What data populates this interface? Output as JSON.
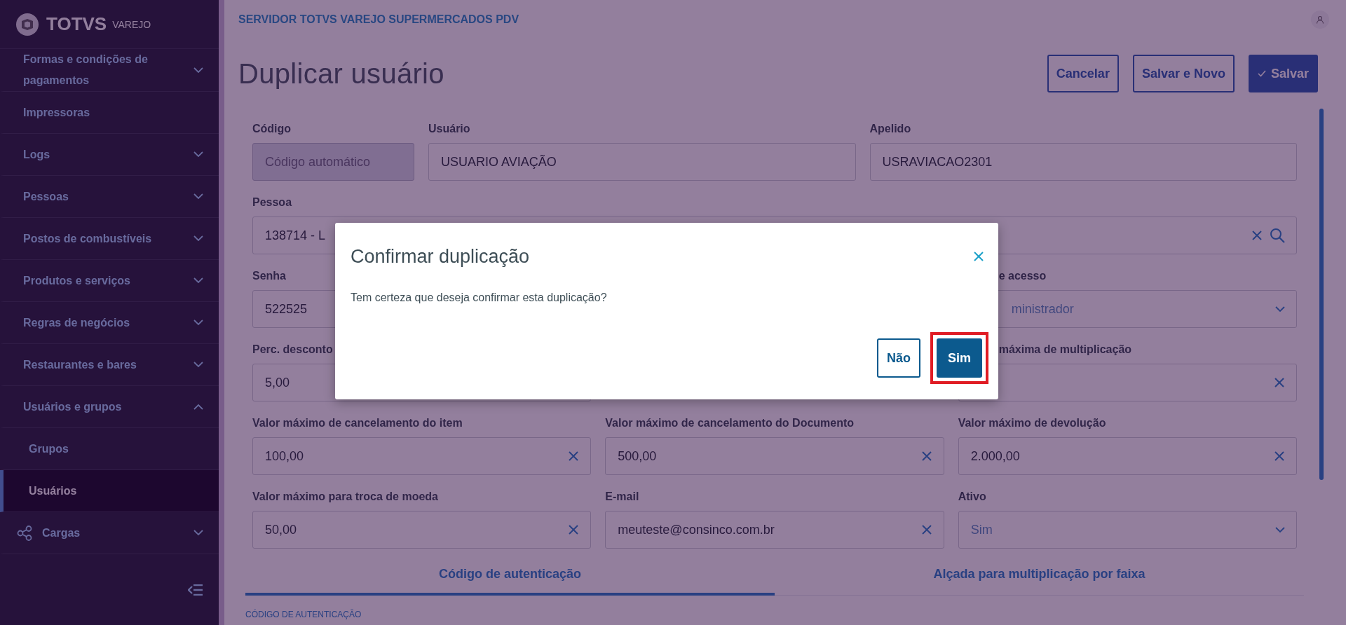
{
  "sidebar": {
    "logo": {
      "brand": "TOTVS",
      "product": "VAREJO"
    },
    "items": [
      {
        "label": "Formas e condições de pagamentos",
        "expandable": true,
        "expanded": false,
        "selected": false
      },
      {
        "label": "Impressoras",
        "expandable": false,
        "selected": false
      },
      {
        "label": "Logs",
        "expandable": true,
        "expanded": false,
        "selected": false
      },
      {
        "label": "Pessoas",
        "expandable": true,
        "expanded": false,
        "selected": false
      },
      {
        "label": "Postos de combustíveis",
        "expandable": true,
        "expanded": false,
        "selected": false
      },
      {
        "label": "Produtos e serviços",
        "expandable": true,
        "expanded": false,
        "selected": false
      },
      {
        "label": "Regras de negócios",
        "expandable": true,
        "expanded": false,
        "selected": false
      },
      {
        "label": "Restaurantes e bares",
        "expandable": true,
        "expanded": false,
        "selected": false
      },
      {
        "label": "Usuários e grupos",
        "expandable": true,
        "expanded": true,
        "selected": false,
        "children": [
          {
            "label": "Grupos",
            "selected": false
          },
          {
            "label": "Usuários",
            "selected": true
          }
        ]
      },
      {
        "label": "Cargas",
        "expandable": true,
        "expanded": false,
        "selected": false,
        "kind": "icon"
      }
    ]
  },
  "header": {
    "server": "SERVIDOR TOTVS VAREJO SUPERMERCADOS PDV"
  },
  "page": {
    "title": "Duplicar usuário",
    "actions": [
      {
        "label": "Cancelar",
        "kind": "secondary"
      },
      {
        "label": "Salvar e Novo",
        "kind": "secondary"
      },
      {
        "label": "Salvar",
        "kind": "primary"
      }
    ]
  },
  "form": {
    "rows": [
      {
        "fields": [
          {
            "label": "Código",
            "placeholder": "Código automático",
            "kind": "text",
            "disabled": true
          },
          {
            "label": "Usuário",
            "value": "USUARIO AVIAÇÃO",
            "kind": "text",
            "disabled": false
          },
          {
            "label": "Apelido",
            "value": "USRAVIACAO2301",
            "kind": "text",
            "disabled": false
          }
        ]
      },
      {
        "fields": [
          {
            "label": "Pessoa",
            "value": "138714 - L",
            "kind": "search",
            "disabled": false
          }
        ]
      },
      {
        "fields": [
          {
            "label": "Senha",
            "value": "522525",
            "kind": "text",
            "disabled": false
          },
          {
            "label": "e acesso",
            "value": "ministrador",
            "kind": "select",
            "disabled": false,
            "clipped": true
          }
        ]
      },
      {
        "fields": [
          {
            "label": "Perc. desconto",
            "value": "5,00",
            "kind": "text",
            "disabled": false
          },
          {
            "label": "máxima de multiplicação",
            "kind": "clear",
            "disabled": false,
            "clipped": true
          }
        ]
      },
      {
        "fields": [
          {
            "label": "Valor máximo de cancelamento do item",
            "value": "100,00",
            "kind": "clear",
            "disabled": false
          },
          {
            "label": "Valor máximo de cancelamento do Documento",
            "value": "500,00",
            "kind": "clear",
            "disabled": false
          },
          {
            "label": "Valor máximo de devolução",
            "value": "2.000,00",
            "kind": "clear",
            "disabled": false
          }
        ]
      },
      {
        "fields": [
          {
            "label": "Valor máximo para troca de moeda",
            "value": "50,00",
            "kind": "clear",
            "disabled": false
          },
          {
            "label": "E-mail",
            "value": "meuteste@consinco.com.br",
            "kind": "clear",
            "disabled": false
          },
          {
            "label": "Ativo",
            "value": "Sim",
            "kind": "select",
            "disabled": false
          }
        ]
      }
    ]
  },
  "tabs": [
    {
      "label": "Código de autenticação",
      "selected": true
    },
    {
      "label": "Alçada para multiplicação por faixa",
      "selected": false
    }
  ],
  "section": {
    "title": "CÓDIGO DE AUTENTICAÇÃO"
  },
  "dialog": {
    "title": "Confirmar duplicação",
    "message": "Tem certeza que deseja confirmar esta duplicação?",
    "buttons": [
      {
        "label": "Não",
        "kind": "secondary",
        "highlighted": false
      },
      {
        "label": "Sim",
        "kind": "primary",
        "highlighted": true
      }
    ]
  }
}
